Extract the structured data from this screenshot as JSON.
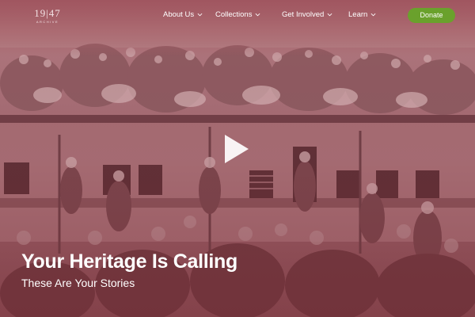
{
  "brand": {
    "logo_main": "19|47",
    "logo_sub": "ARCHIVE"
  },
  "nav": {
    "items": [
      {
        "label": "About Us",
        "icon": "chevron-down-icon"
      },
      {
        "label": "Collections",
        "icon": "chevron-down-icon"
      },
      {
        "label": "Get Involved",
        "icon": "chevron-down-icon"
      },
      {
        "label": "Learn",
        "icon": "chevron-down-icon"
      }
    ],
    "donate_label": "Donate"
  },
  "hero": {
    "title": "Your Heritage Is Calling",
    "subtitle": "These Are Your Stories",
    "play_icon": "play-icon"
  },
  "colors": {
    "accent": "#6aa12c",
    "overlay": "#9c5a63",
    "text": "#ffffff"
  }
}
